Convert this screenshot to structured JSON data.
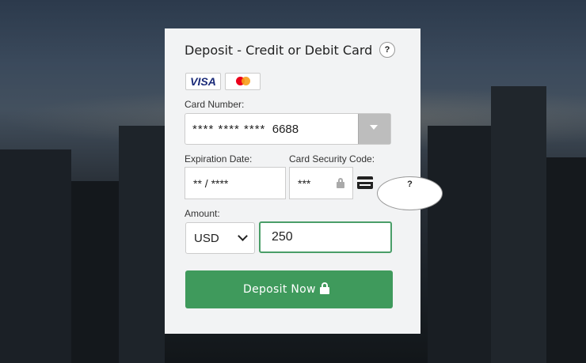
{
  "form": {
    "title": "Deposit - Credit or Debit Card",
    "help_label": "?",
    "brands": {
      "visa_label": "VISA",
      "mastercard_icon": "mastercard-logo"
    },
    "card_number_label": "Card Number:",
    "card_number_masked": "****  ****  ****",
    "card_number_last4": "6688",
    "expiration_label": "Expiration Date:",
    "expiration_value": "** / ****",
    "cvv_label": "Card Security Code:",
    "cvv_value": "***",
    "amount_label": "Amount:",
    "currency_selected": "USD",
    "amount_value": "250",
    "submit_label": "Deposit Now"
  },
  "colors": {
    "accent_green": "#3f9a5c",
    "amount_border": "#4a9e68",
    "card_bg": "#f2f3f4"
  },
  "icons": [
    "help-icon",
    "visa-logo",
    "mastercard-logo",
    "chevron-down-icon",
    "lock-icon",
    "credit-card-icon"
  ]
}
